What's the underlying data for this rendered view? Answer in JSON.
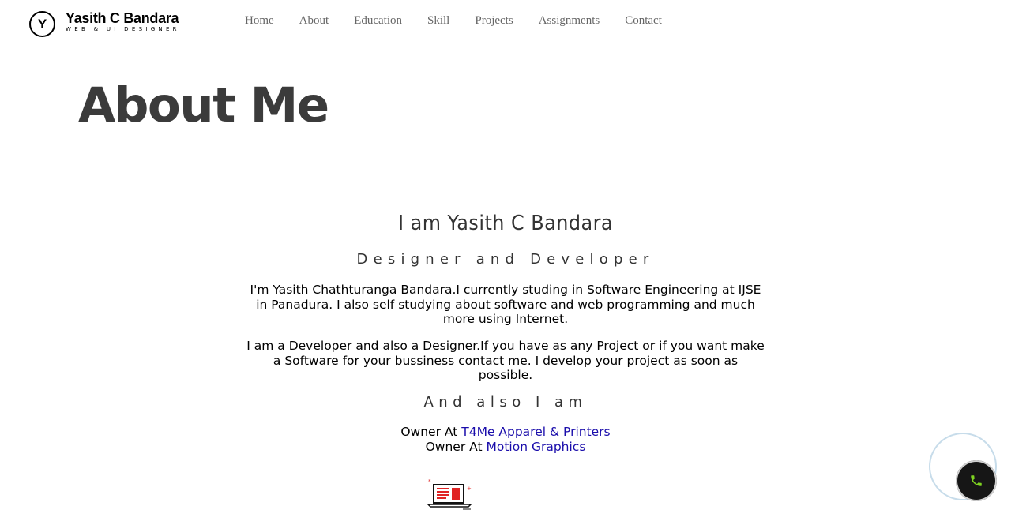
{
  "brand": {
    "logo_letter": "Y",
    "name": "Yasith C Bandara",
    "tagline": "WEB & UI DESIGNER"
  },
  "nav": {
    "items": [
      {
        "label": "Home"
      },
      {
        "label": "About"
      },
      {
        "label": "Education"
      },
      {
        "label": "Skill"
      },
      {
        "label": "Projects"
      },
      {
        "label": "Assignments"
      },
      {
        "label": "Contact"
      }
    ]
  },
  "about": {
    "heading": "About Me",
    "intro": "I am Yasith C Bandara",
    "role": "Designer and Developer",
    "paragraph1": "I'm Yasith Chathturanga Bandara.I currently studing in Software Engineering at IJSE in Panadura. I also self studying about software and web programming and much more using Internet.",
    "paragraph2": "I am a Developer and also a Designer.If you have as any Project or if you want make a Software for your bussiness contact me. I develop your project as soon as possible.",
    "also": "And also I am",
    "owners": [
      {
        "prefix": "Owner At",
        "link": "T4Me Apparel & Printers"
      },
      {
        "prefix": "Owner At",
        "link": "Motion Graphics"
      }
    ]
  },
  "colors": {
    "heading": "#3b3b3b",
    "nav_text": "#666666",
    "link": "#1a0dab",
    "call_button": "#161616",
    "call_icon": "#7ed321",
    "laptop_accent": "#e02424"
  },
  "icons": {
    "call": "phone-icon",
    "illustration": "laptop-icon"
  }
}
